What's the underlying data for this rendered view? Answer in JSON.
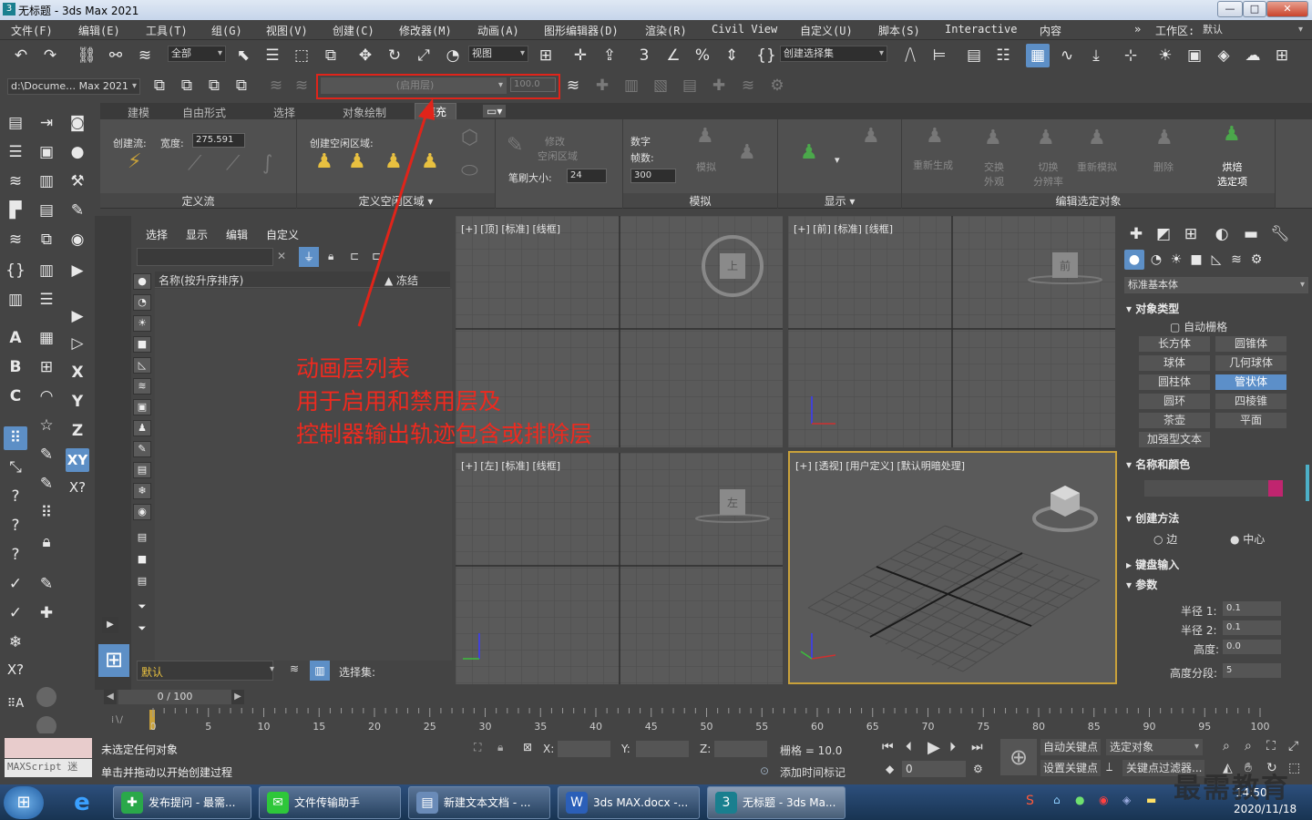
{
  "window": {
    "title": "无标题 - 3ds Max 2021",
    "min": "—",
    "max": "□",
    "close": "✕"
  },
  "menu": [
    "文件(F)",
    "编辑(E)",
    "工具(T)",
    "组(G)",
    "视图(V)",
    "创建(C)",
    "修改器(M)",
    "动画(A)",
    "图形编辑器(D)",
    "渲染(R)",
    "Civil View",
    "自定义(U)",
    "脚本(S)",
    "Interactive",
    "内容"
  ],
  "workspace": {
    "label": "工作区:",
    "value": "默认",
    "chev": "»"
  },
  "toolbar1": {
    "filter": "全部",
    "refcoord": "视图",
    "selset": "创建选择集"
  },
  "toolbar2": {
    "path": "d:\\Docume… Max 2021",
    "layer": "(启用层)",
    "weight": "100.0"
  },
  "ribbon": {
    "tabs": [
      "建模",
      "自由形式",
      "选择",
      "对象绘制",
      "填充"
    ],
    "active_tab": "填充",
    "g1": {
      "flow": "创建流:",
      "width_label": "宽度:",
      "width": "275.591",
      "title": "定义流"
    },
    "g2": {
      "label": "创建空闲区域:",
      "title": "定义空闲区域 ▾"
    },
    "g3": {
      "modify": "修改",
      "idle": "空闲区域",
      "brush_label": "笔刷大小:",
      "brush": "24"
    },
    "g4": {
      "digital": "数字",
      "frames_label": "帧数:",
      "frames": "300",
      "sim": "模拟",
      "title": "模拟"
    },
    "g5": {
      "title": "显示 ▾"
    },
    "g6": {
      "items": [
        "重新生成",
        "交换\n外观",
        "切换\n分辨率",
        "重新模拟",
        "删除",
        "烘焙\n选定项"
      ],
      "title": "编辑选定对象"
    }
  },
  "scene": {
    "menus": [
      "选择",
      "显示",
      "编辑",
      "自定义"
    ],
    "col_name": "名称(按升序排序)",
    "col_freeze": "▲ 冻结",
    "layer_default": "默认",
    "selset_label": "选择集:"
  },
  "viewports": {
    "top": "[+] [顶] [标准] [线框]",
    "front": "[+] [前] [标准] [线框]",
    "left": "[+] [左] [标准] [线框]",
    "persp": "[+] [透视] [用户定义] [默认明暗处理]",
    "cube_top": "上",
    "cube_front": "前",
    "cube_left": "左"
  },
  "annotation": {
    "lines": [
      "动画层列表",
      "用于启用和禁用层及",
      "控制器输出轨迹包含或排除层"
    ]
  },
  "cmdpanel": {
    "category": "标准基本体",
    "obj_type": "对象类型",
    "autogrid": "自动栅格",
    "buttons": [
      "长方体",
      "圆锥体",
      "球体",
      "几何球体",
      "圆柱体",
      "管状体",
      "圆环",
      "四棱锥",
      "茶壶",
      "平面",
      "加强型文本"
    ],
    "selected_button": "管状体",
    "name_color": "名称和颜色",
    "color": "#c0256f",
    "create_method": "创建方法",
    "edge": "边",
    "center": "中心",
    "keyboard": "键盘输入",
    "params": "参数",
    "radius1_label": "半径 1:",
    "radius1": "0.1",
    "radius2_label": "半径 2:",
    "radius2": "0.1",
    "height_label": "高度:",
    "height": "0.0",
    "segs_label": "高度分段:",
    "segs": "5"
  },
  "timeline": {
    "frame": "0 / 100",
    "ticks": [
      "0",
      "5",
      "10",
      "15",
      "20",
      "25",
      "30",
      "35",
      "40",
      "45",
      "50",
      "55",
      "60",
      "65",
      "70",
      "75",
      "80",
      "85",
      "90",
      "95",
      "100"
    ]
  },
  "status": {
    "maxscript": "MAXScript 迷",
    "msg1": "未选定任何对象",
    "msg2": "单击并拖动以开始创建过程",
    "x": "X:",
    "y": "Y:",
    "z": "Z:",
    "grid": "栅格 = 10.0",
    "addtime": "添加时间标记",
    "autokey": "自动关键点",
    "setkey": "设置关键点",
    "sel_obj": "选定对象",
    "keyfilter": "关键点过滤器...",
    "frame": "0"
  },
  "taskbar": {
    "items": [
      "发布提问 - 最需...",
      "文件传输助手",
      "新建文本文档 - ...",
      "3ds MAX.docx -...",
      "无标题 - 3ds Ma..."
    ],
    "time": "14:50",
    "date": "2020/11/18",
    "watermark": "最需教育"
  }
}
